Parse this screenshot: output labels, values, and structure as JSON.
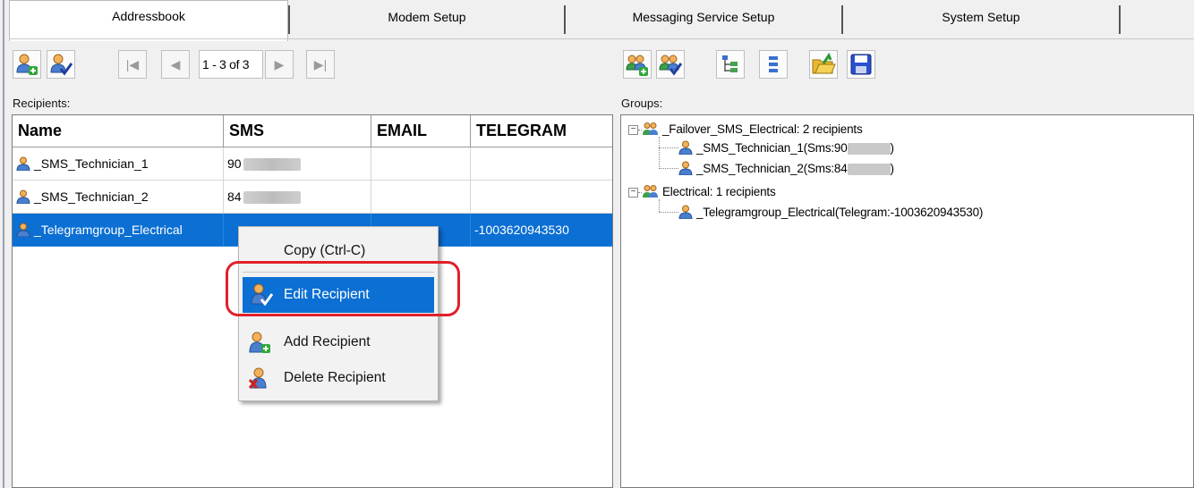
{
  "tabs": [
    {
      "label": "Addressbook",
      "active": true
    },
    {
      "label": "Modem Setup",
      "active": false
    },
    {
      "label": "Messaging Service Setup",
      "active": false
    },
    {
      "label": "System Setup",
      "active": false
    }
  ],
  "pager": {
    "text": "1 - 3 of 3"
  },
  "labels": {
    "recipients": "Recipients:",
    "groups": "Groups:"
  },
  "columns": [
    "Name",
    "SMS",
    "EMAIL",
    "TELEGRAM"
  ],
  "recipients": [
    {
      "name": "_SMS_Technician_1",
      "sms": "90",
      "email": "",
      "telegram": ""
    },
    {
      "name": "_SMS_Technician_2",
      "sms": "84",
      "email": "",
      "telegram": ""
    },
    {
      "name": "_Telegramgroup_Electrical",
      "sms": "",
      "email": "",
      "telegram": "-1003620943530",
      "selected": true
    }
  ],
  "groups": [
    {
      "label": "_Failover_SMS_Electrical: 2 recipients",
      "children": [
        {
          "prefix": "_SMS_Technician_1(Sms:90",
          "suffix": ")"
        },
        {
          "prefix": "_SMS_Technician_2(Sms:84",
          "suffix": ")"
        }
      ]
    },
    {
      "label": "Electrical: 1 recipients",
      "children": [
        {
          "prefix": "_Telegramgroup_Electrical(Telegram:-1003620943530)",
          "suffix": ""
        }
      ]
    }
  ],
  "context_menu": [
    {
      "label": "Copy (Ctrl-C)"
    },
    {
      "label": "Edit Recipient",
      "highlighted": true
    },
    {
      "label": "Add Recipient"
    },
    {
      "label": "Delete Recipient"
    }
  ],
  "colors": {
    "selection": "#0b6fd3",
    "annotation": "#e0202a"
  }
}
